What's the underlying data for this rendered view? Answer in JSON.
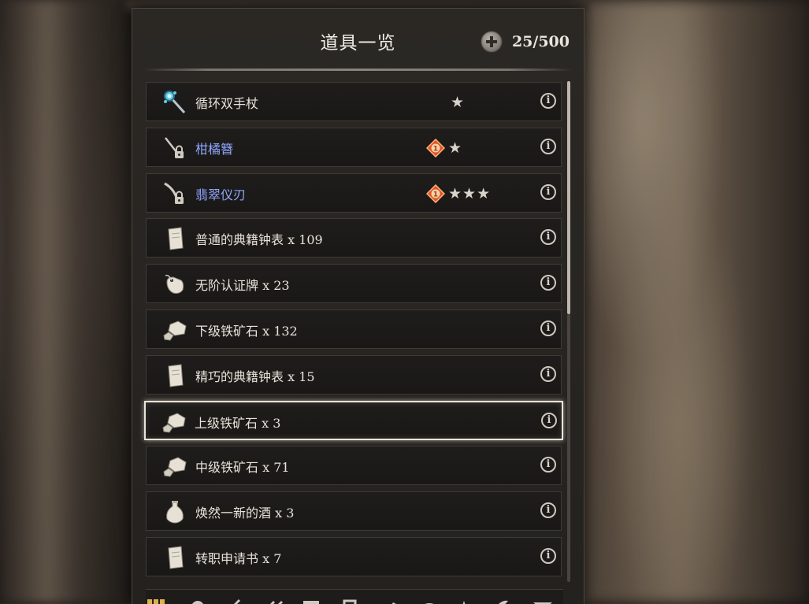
{
  "header": {
    "title": "道具一览",
    "capacity": "25/500"
  },
  "items": [
    {
      "name": "循环双手杖",
      "icon": "staff-icon",
      "stars": "★",
      "warning": false,
      "blue": false
    },
    {
      "name": "柑橘簪",
      "icon": "locked-hairpin-icon",
      "stars": "★",
      "warning": true,
      "warning_label": "1",
      "blue": true
    },
    {
      "name": "翡翠仪刃",
      "icon": "locked-blade-icon",
      "stars": "★★★",
      "warning": true,
      "warning_label": "1",
      "blue": true
    },
    {
      "name": "普通的典籍钟表 x 109",
      "icon": "scroll-icon",
      "stars": "",
      "warning": false,
      "blue": false
    },
    {
      "name": "无阶认证牌 x 23",
      "icon": "tag-icon",
      "stars": "",
      "warning": false,
      "blue": false
    },
    {
      "name": "下级铁矿石 x 132",
      "icon": "ore-icon",
      "stars": "",
      "warning": false,
      "blue": false
    },
    {
      "name": "精巧的典籍钟表 x 15",
      "icon": "scroll-icon",
      "stars": "",
      "warning": false,
      "blue": false
    },
    {
      "name": "上级铁矿石 x 3",
      "icon": "ore-icon",
      "stars": "",
      "warning": false,
      "blue": false,
      "selected": true
    },
    {
      "name": "中级铁矿石 x 71",
      "icon": "ore-icon",
      "stars": "",
      "warning": false,
      "blue": false
    },
    {
      "name": "焕然一新的酒 x 3",
      "icon": "bottle-icon",
      "stars": "",
      "warning": false,
      "blue": false
    },
    {
      "name": "转职申请书 x 7",
      "icon": "scroll-icon",
      "stars": "",
      "warning": false,
      "blue": false
    }
  ],
  "info_glyph": "i",
  "colors": {
    "panel_bg": "#24221f",
    "row_bg": "#1b1918",
    "text": "#e8e3da",
    "blue_name": "#8fa6ff",
    "warning_orange": "#e0552a",
    "selected_border": "#e9e4d8"
  }
}
